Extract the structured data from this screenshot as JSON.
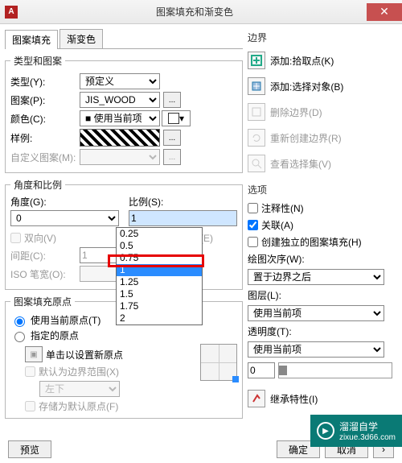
{
  "window": {
    "title": "图案填充和渐变色",
    "app_icon_letter": "A"
  },
  "tabs": {
    "hatch": "图案填充",
    "gradient": "渐变色"
  },
  "type_pattern": {
    "legend": "类型和图案",
    "type_label": "类型(Y):",
    "type_value": "预定义",
    "pattern_label": "图案(P):",
    "pattern_value": "JIS_WOOD",
    "color_label": "颜色(C):",
    "color_value": "使用当前项",
    "sample_label": "样例:",
    "custom_label": "自定义图案(M):"
  },
  "angle_scale": {
    "legend": "角度和比例",
    "angle_label": "角度(G):",
    "angle_value": "0",
    "scale_label": "比例(S):",
    "scale_value": "1",
    "double_label": "双向(V)",
    "paper_label": "相对图纸空间(E)",
    "spacing_label": "间距(C):",
    "spacing_value": "1",
    "iso_label": "ISO 笔宽(O):",
    "options": [
      "0.25",
      "0.5",
      "0.75",
      "1",
      "1.25",
      "1.5",
      "1.75",
      "2"
    ],
    "highlight_index": 3
  },
  "origin": {
    "legend": "图案填充原点",
    "use_current": "使用当前原点(T)",
    "specified": "指定的原点",
    "click_set": "单击以设置新原点",
    "default_bounds": "默认为边界范围(X)",
    "corner_value": "左下",
    "store_default": "存储为默认原点(F)"
  },
  "boundary": {
    "title": "边界",
    "add_pick": "添加:拾取点(K)",
    "add_select": "添加:选择对象(B)",
    "remove": "删除边界(D)",
    "recreate": "重新创建边界(R)",
    "view_sel": "查看选择集(V)"
  },
  "options": {
    "title": "选项",
    "annotative": "注释性(N)",
    "associative": "关联(A)",
    "independent": "创建独立的图案填充(H)",
    "draw_order_label": "绘图次序(W):",
    "draw_order_value": "置于边界之后",
    "layer_label": "图层(L):",
    "layer_value": "使用当前项",
    "transparency_label": "透明度(T):",
    "transparency_value": "使用当前项",
    "transparency_num": "0",
    "inherit": "继承特性(I)"
  },
  "footer": {
    "preview": "预览",
    "ok": "确定",
    "cancel": "取消"
  },
  "watermark": {
    "name": "溜溜自学",
    "sub": "zixue.3d66.com"
  }
}
